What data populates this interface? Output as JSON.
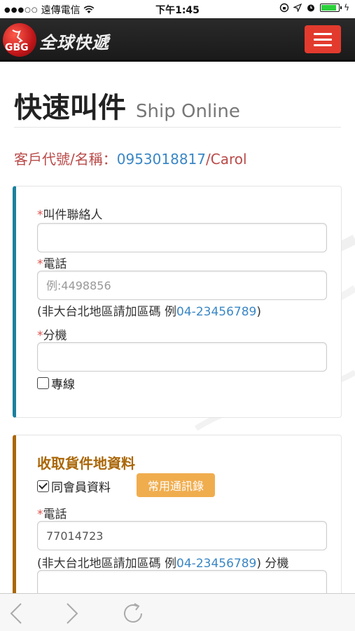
{
  "status_bar": {
    "signal_dots": "●●●○○",
    "carrier": "遠傳電信",
    "time": "下午1:45"
  },
  "header": {
    "logo_badge": "GBG",
    "logo_text": "全球快遞",
    "menu_icon": "hamburger-icon"
  },
  "page": {
    "title_zh": "快速叫件",
    "title_en": "Ship Online",
    "customer_label": "客戶代號/名稱：",
    "customer_id": "0953018817",
    "customer_name": "/Carol"
  },
  "contact_section": {
    "required_mark": "*",
    "contact_label": "叫件聯絡人",
    "contact_value": "",
    "phone_label": "電話",
    "phone_placeholder": "例:4498856",
    "phone_hint_prefix": "(非大台北地區請加區碼 例",
    "phone_hint_example": "04-23456789",
    "phone_hint_suffix": ")",
    "ext_label": "分機",
    "ext_value": "",
    "dedicated_line_label": "專線",
    "dedicated_line_checked": false
  },
  "pickup_section": {
    "title": "收取貨件地資料",
    "same_member_label": "同會員資料",
    "same_member_checked": true,
    "address_book_button": "常用通訊錄",
    "phone_label": "電話",
    "phone_value": "77014723",
    "phone_hint_prefix": "(非大台北地區請加區碼 例",
    "phone_hint_example": "04-23456789",
    "phone_hint_suffix": ") 分機",
    "ext_value": ""
  },
  "toolbar": {
    "back_icon": "chevron-left-icon",
    "forward_icon": "chevron-right-icon",
    "reload_icon": "reload-icon"
  }
}
